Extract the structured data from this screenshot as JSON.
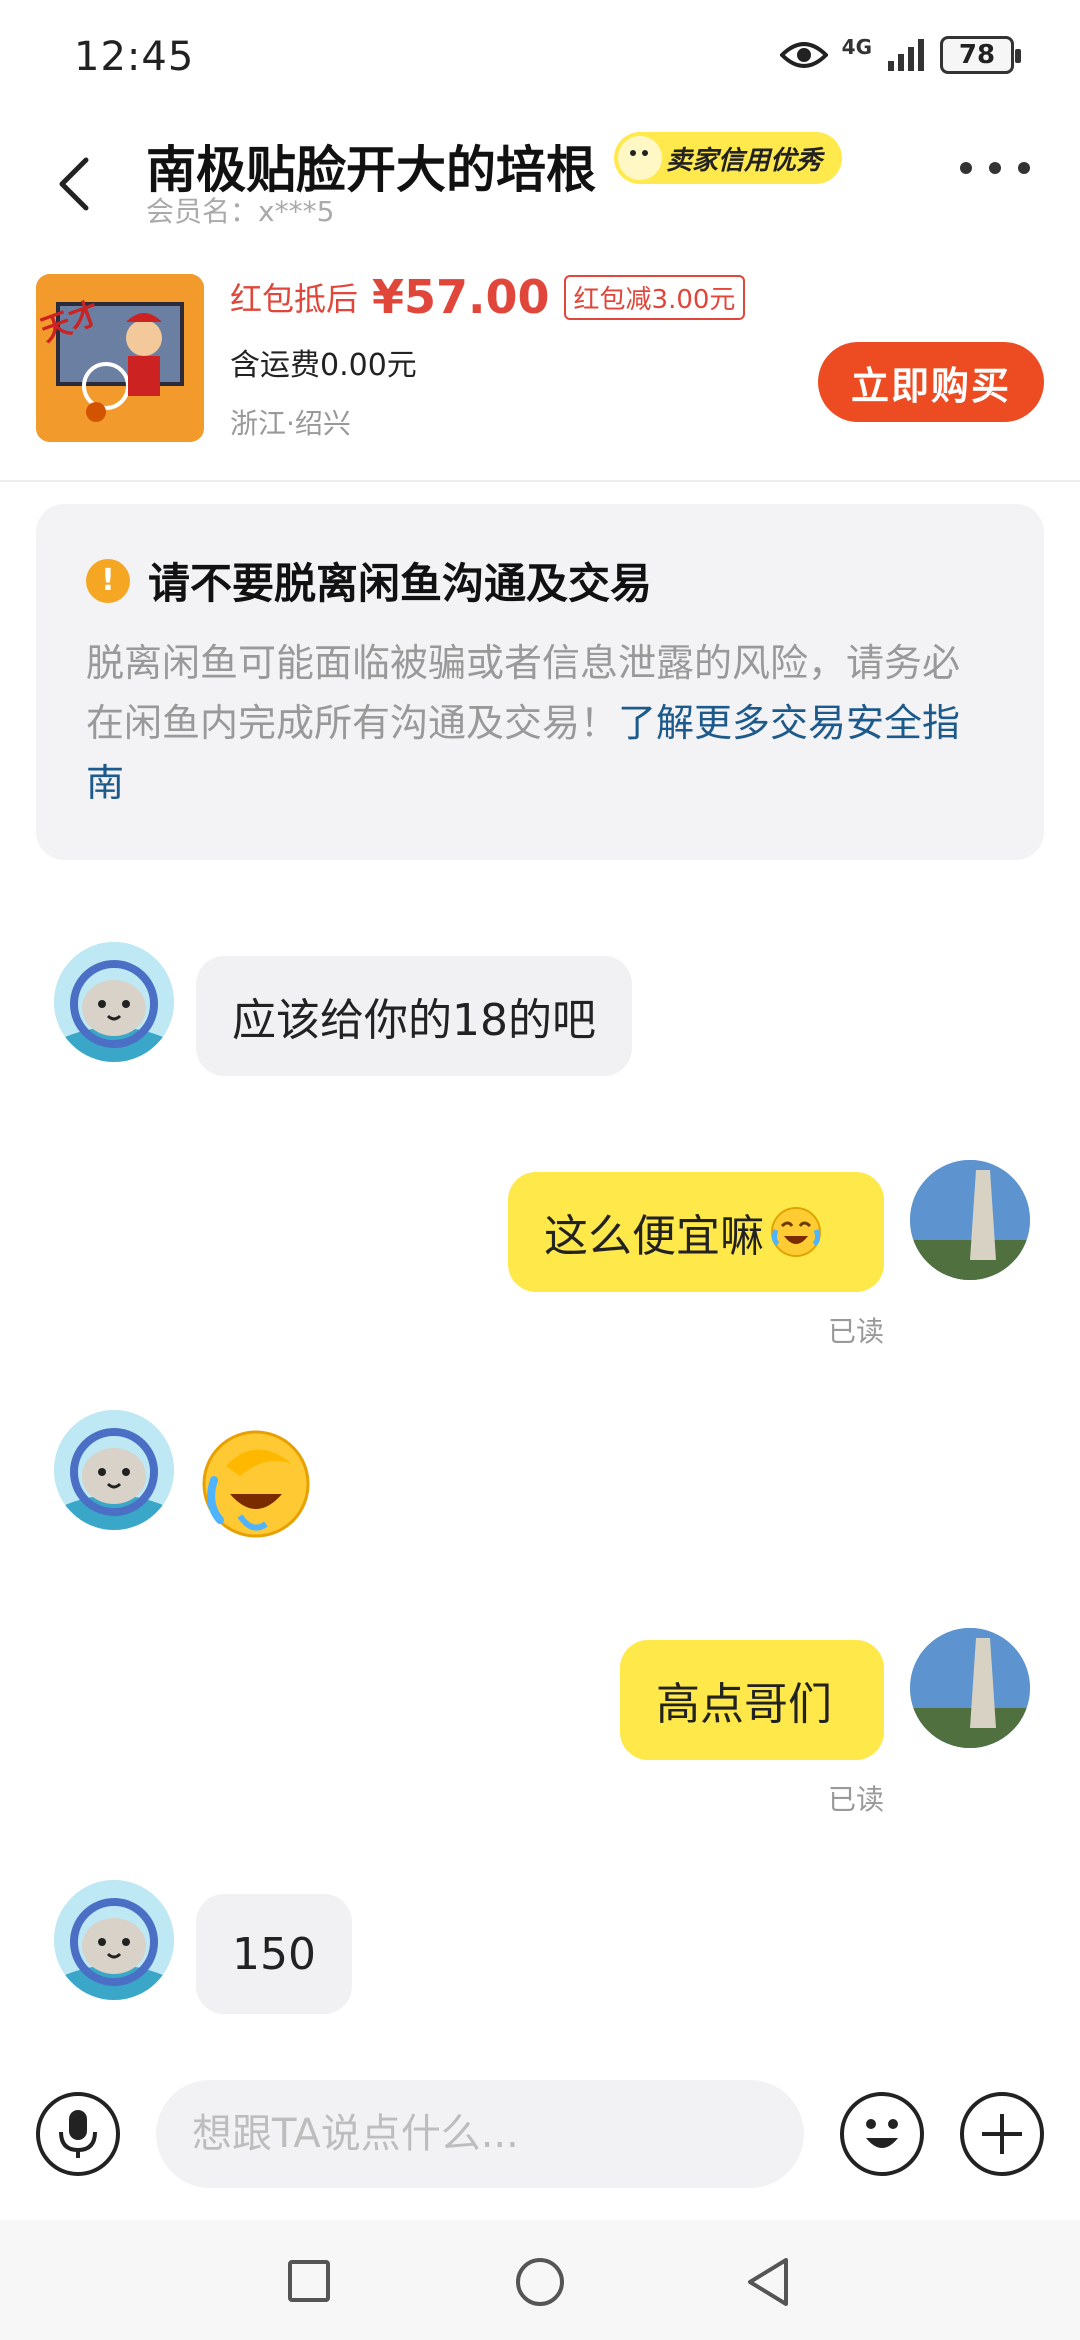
{
  "status_bar": {
    "time": "12:45",
    "network": "4G",
    "battery": "78"
  },
  "header": {
    "title": "南极贴脸开大的培根",
    "credit_badge": "卖家信用优秀",
    "member": "会员名：x***5"
  },
  "product": {
    "price_prefix": "红包抵后",
    "price": "¥57.00",
    "coupon": "红包减3.00元",
    "shipping": "含运费0.00元",
    "location": "浙江·绍兴",
    "buy_label": "立即购买"
  },
  "notice": {
    "title": "请不要脱离闲鱼沟通及交易",
    "body": "脱离闲鱼可能面临被骗或者信息泄露的风险，请务必在闲鱼内完成所有沟通及交易！",
    "link": "了解更多交易安全指南"
  },
  "messages": [
    {
      "from": "other",
      "text": "应该给你的18的吧"
    },
    {
      "from": "me",
      "text": "这么便宜嘛",
      "emoji": "crying-laughing-emoji",
      "read": "已读"
    },
    {
      "from": "other",
      "sticker": "facepalm-crying-emoji"
    },
    {
      "from": "me",
      "text": "高点哥们",
      "read": "已读"
    },
    {
      "from": "other",
      "text": "150"
    }
  ],
  "input": {
    "placeholder": "想跟TA说点什么..."
  },
  "icons": {
    "back": "chevron-left-icon",
    "more": "more-dots-icon",
    "mic": "microphone-icon",
    "emoji": "smiley-icon",
    "plus": "plus-icon"
  },
  "colors": {
    "accent_yellow": "#ffe84a",
    "price_red": "#e0463a",
    "buy_orange": "#ed4c22",
    "link_blue": "#1d5a8c"
  }
}
